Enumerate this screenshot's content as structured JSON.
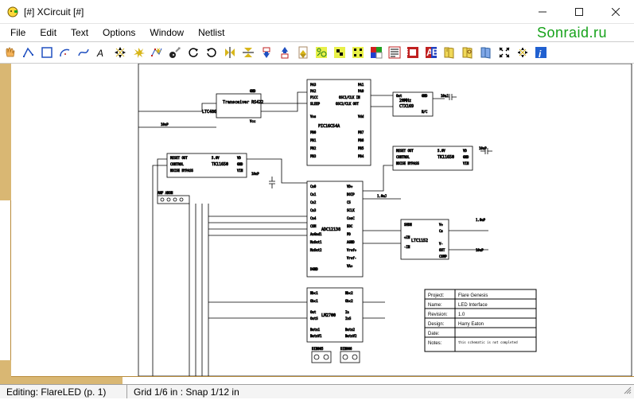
{
  "window": {
    "title": "[#] XCircuit [#]",
    "watermark": "Sonraid.ru"
  },
  "menu": [
    "File",
    "Edit",
    "Text",
    "Options",
    "Window",
    "Netlist"
  ],
  "toolbar_icons": [
    "hand-pan-icon",
    "wire-icon",
    "box-icon",
    "arc-icon",
    "spline-icon",
    "text-label-icon",
    "move-icon",
    "copy-icon",
    "edit-points-icon",
    "delete-icon",
    "rotate-ccw-icon",
    "rotate-cw-icon",
    "flip-h-icon",
    "flip-v-icon",
    "push-down-icon",
    "pop-up-icon",
    "page-icon",
    "make-object-icon",
    "join-icon",
    "unjoin-icon",
    "colors-icon",
    "params-icon",
    "border-icon",
    "fill-icon",
    "library-icon",
    "library2-icon",
    "page-directory-icon",
    "zoom-fit-icon",
    "zoom-box-icon",
    "help-icon"
  ],
  "status": {
    "editing": "Editing: FlareLED (p. 1)",
    "grid": "Grid 1/6 in : Snap 1/12 in"
  },
  "schematic": {
    "components": {
      "transceiver": {
        "name": "Transceiver RS422",
        "ref": "LTC486",
        "pins_left": [
          "GND",
          "Vcc"
        ]
      },
      "pic": {
        "name": "PIC16C54A",
        "pins_left": [
          "PA3",
          "PA2",
          "P1CC",
          "SLEEP",
          "Vss",
          "PB0",
          "PB1",
          "PB2",
          "PB3"
        ],
        "pins_right": [
          "PA1",
          "PA0",
          "OSC1/CLK IN",
          "OSC2/CLK OUT",
          "Vdd",
          "PB7",
          "PB6",
          "PB5",
          "PB4"
        ]
      },
      "osc": {
        "lines": [
          "Out",
          "GND",
          "20MHz",
          "CTX169",
          "N/C"
        ]
      },
      "reg1": {
        "lines": [
          "RESET OUT",
          "CONTROL",
          "NOISE BYPASS",
          "5.0V",
          "TK11650",
          "VD",
          "GND",
          "VIN"
        ]
      },
      "reg2": {
        "lines": [
          "RESET OUT",
          "CONTROL",
          "NOISE BYPASS",
          "5.0V",
          "TK11650",
          "VD",
          "GND",
          "VIN"
        ]
      },
      "adc": {
        "name": "ADC12138",
        "pins_left": [
          "Cn0",
          "Cn1",
          "Cn2",
          "Cn3",
          "Cn4",
          "COM",
          "AnGnd1",
          "MxOut1",
          "MxOut2",
          "DGND"
        ],
        "pins_right": [
          "VD+",
          "DOIP",
          "CS",
          "SCLK",
          "ConC",
          "EOC",
          "PD",
          "AGND",
          "Vref+",
          "Vref-",
          "VA+"
        ]
      },
      "ltc1152": {
        "name": "LTC1152",
        "pins": [
          "SHDN",
          "V+",
          "Cs",
          "+IN",
          "-IN",
          "V-",
          "OUT",
          "COMP"
        ]
      },
      "lm2700": {
        "name": "LM2700",
        "pins_left": [
          "Nbc1",
          "Obc1",
          "Out",
          "OutS",
          "Butn1",
          "ButnV1"
        ],
        "pins_right": [
          "Nbc2",
          "Obc2",
          "In",
          "InS",
          "Butn2",
          "ButnV2"
        ]
      },
      "connectors": [
        "DIN005",
        "DIN006"
      ]
    },
    "nets": [
      "10nP",
      "10nP",
      "10uJ",
      "10uP",
      "1.0uJ",
      "1.0uP",
      "10uP"
    ],
    "signal_bus": "ANF ANON"
  },
  "titleblock": {
    "rows": [
      {
        "k": "Project:",
        "v": "Flare Genesis"
      },
      {
        "k": "Name:",
        "v": "LED Interface"
      },
      {
        "k": "Revision:",
        "v": "1.0"
      },
      {
        "k": "Design:",
        "v": "Harry Eaton"
      },
      {
        "k": "Date:",
        "v": ""
      },
      {
        "k": "Notes:",
        "v": "this schematic is not completed"
      }
    ]
  }
}
